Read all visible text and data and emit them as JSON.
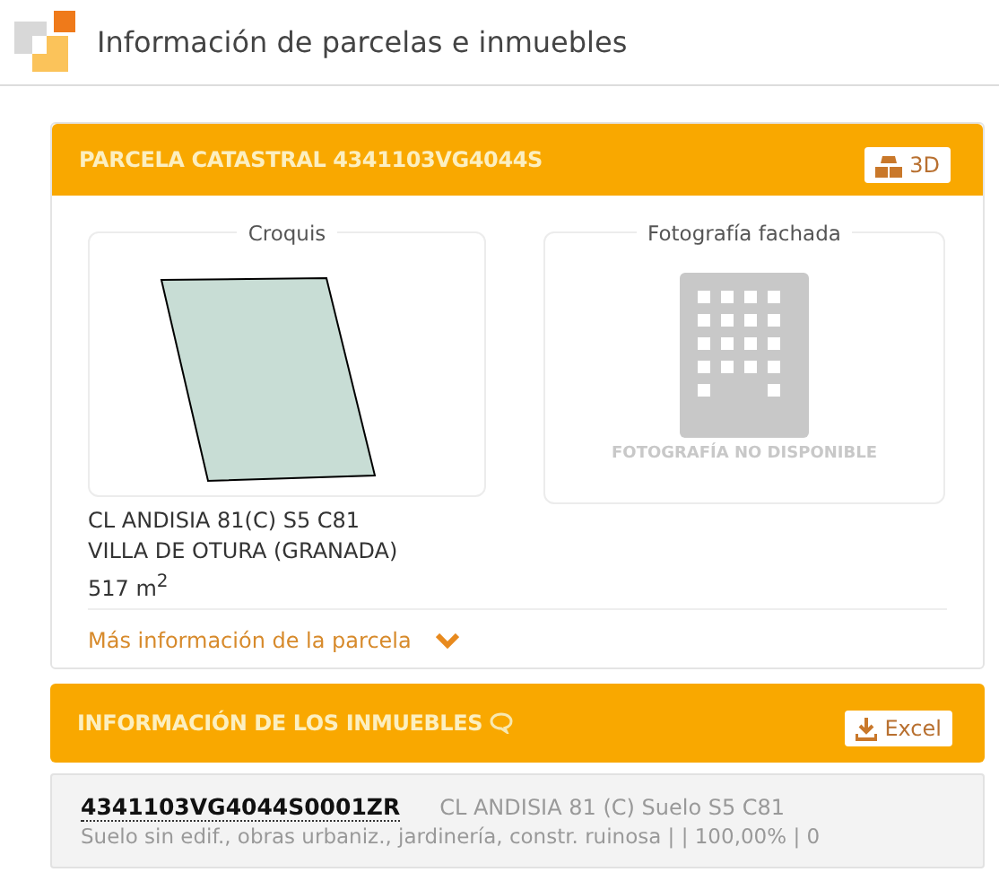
{
  "header": {
    "title": "Información de parcelas e inmuebles"
  },
  "parcel": {
    "title": "PARCELA CATASTRAL 4341103VG4044S",
    "button_3d": "3D",
    "sketch_label": "Croquis",
    "photo_label": "Fotografía fachada",
    "photo_unavailable": "FOTOGRAFÍA NO DISPONIBLE",
    "address_lines": [
      "CL ANDISIA 81(C) S5 C81",
      "VILLA DE OTURA (GRANADA)"
    ],
    "area": "517 m$^{2}$",
    "more_link": "Más información de la parcela"
  },
  "properties": {
    "title": "INFORMACIÓN DE LOS INMUEBLES",
    "export_button": "Excel",
    "rows": [
      {
        "reference": "4341103VG4044S0001ZR",
        "address": "CL ANDISIA 81 (C) Suelo S5 C81",
        "details": "Suelo sin edif., obras urbaniz., jardinería, constr. ruinosa | | 100,00% | 0"
      }
    ]
  }
}
